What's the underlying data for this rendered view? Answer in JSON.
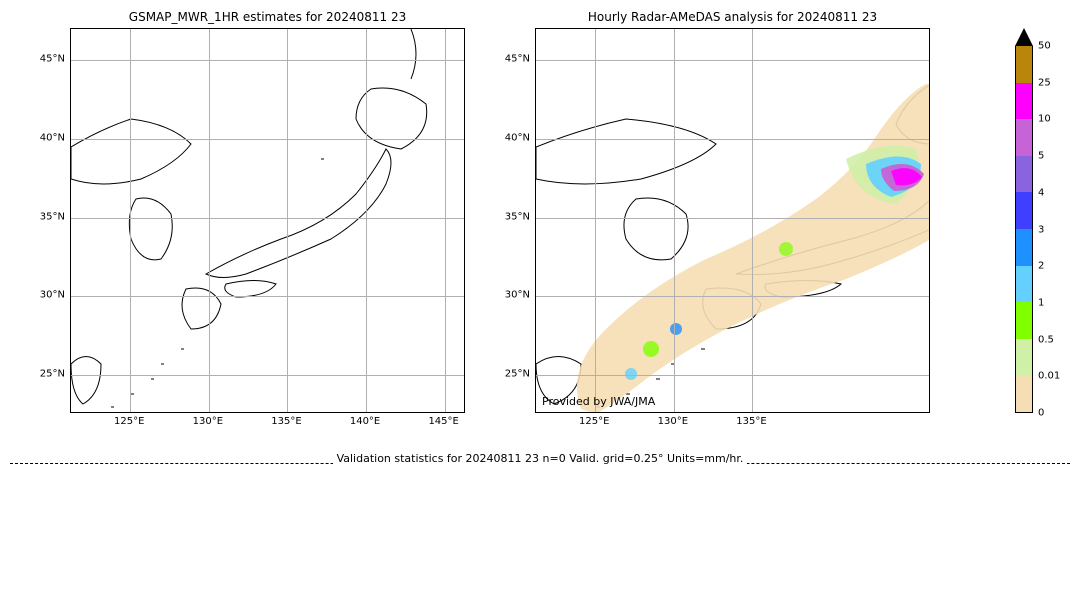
{
  "panels": {
    "left": {
      "title": "GSMAP_MWR_1HR estimates for 20240811 23",
      "lat_ticks": [
        "25°N",
        "30°N",
        "35°N",
        "40°N",
        "45°N"
      ],
      "lon_ticks": [
        "125°E",
        "130°E",
        "135°E",
        "140°E",
        "145°E"
      ],
      "lon_range": [
        121.23,
        146.35
      ],
      "lat_range": [
        22.5,
        47
      ]
    },
    "right": {
      "title": "Hourly Radar-AMeDAS analysis for 20240811 23",
      "lat_ticks": [
        "25°N",
        "30°N",
        "35°N",
        "40°N",
        "45°N"
      ],
      "lon_ticks": [
        "125°E",
        "130°E",
        "135°E"
      ],
      "lon_range": [
        121.23,
        139.52
      ],
      "lat_range": [
        22.5,
        47
      ],
      "provided_by": "Provided by JWA/JMA"
    }
  },
  "colorbar": {
    "labels": [
      "50",
      "25",
      "10",
      "5",
      "4",
      "3",
      "2",
      "1",
      "0.5",
      "0.01",
      "0"
    ],
    "colors": [
      "#b8860b",
      "#ff00ff",
      "#c663d6",
      "#8a63e0",
      "#3f3fff",
      "#1e90ff",
      "#63d0ff",
      "#7fff00",
      "#d0f0a8",
      "#f5deb3"
    ]
  },
  "footer": "Validation statistics for 20240811 23  n=0 Valid. grid=0.25° Units=mm/hr.",
  "chart_data": {
    "type": "map",
    "description": "Two geographic precipitation map panels over Japan region.",
    "panels": [
      {
        "name": "GSMAP_MWR_1HR",
        "datetime": "2024-08-11 23:00",
        "bounds": {
          "lat": [
            22.5,
            47
          ],
          "lon": [
            121.23,
            146.35
          ]
        },
        "data_points": []
      },
      {
        "name": "Radar-AMeDAS",
        "datetime": "2024-08-11 23:00",
        "bounds": {
          "lat": [
            22.5,
            47
          ],
          "lon": [
            121.23,
            139.52
          ]
        },
        "precip_regions_mm_per_hr": [
          {
            "region": "broad Japan archipelago halo",
            "value_range": "0.01-0.5"
          },
          {
            "region": "Tohoku/N. Honshu east coast",
            "value_range": "5-25"
          },
          {
            "region": "scattered Kyushu/Okinawa cells",
            "value_range": "1-4"
          }
        ]
      }
    ],
    "color_scale": {
      "breaks": [
        0,
        0.01,
        0.5,
        1,
        2,
        3,
        4,
        5,
        10,
        25,
        50
      ],
      "units": "mm/hr"
    }
  }
}
